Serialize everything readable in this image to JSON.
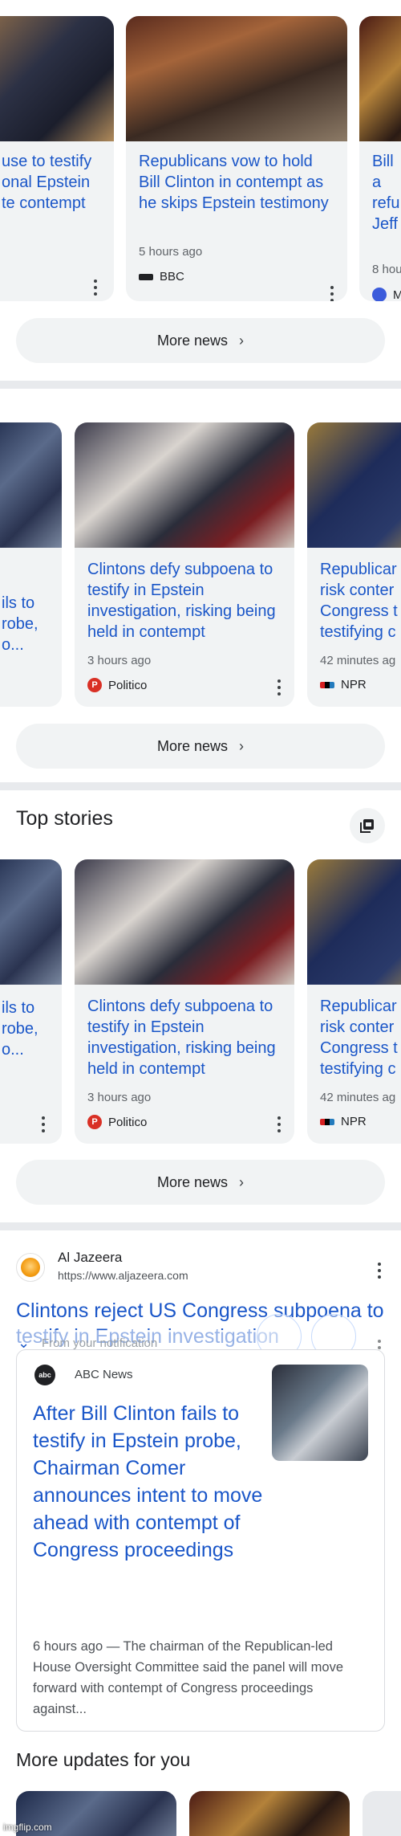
{
  "carousel1": {
    "cards": [
      {
        "title": "use to testify onal Epstein te contempt"
      },
      {
        "title": "Republicans vow to hold Bill Clinton in contempt as he skips Epstein testimony",
        "time": "5 hours ago",
        "source": "BBC"
      },
      {
        "title": "Bill a refu Jeff",
        "time": "8 hou",
        "source": "M"
      }
    ],
    "more_label": "More news"
  },
  "carousel2": {
    "cards": [
      {
        "title": "ils to robe, o..."
      },
      {
        "title": "Clintons defy subpoena to testify in Epstein investigation, risking being held in contempt",
        "time": "3 hours ago",
        "source": "Politico",
        "source_color": "#d93025",
        "source_letter": "P"
      },
      {
        "title": "Republicar risk conter Congress t testifying c",
        "time": "42 minutes ag",
        "source": "NPR"
      }
    ],
    "more_label": "More news"
  },
  "top_stories": {
    "heading": "Top stories",
    "cards": [
      {
        "title": "ils to robe, o..."
      },
      {
        "title": "Clintons defy subpoena to testify in Epstein investigation, risking being held in contempt",
        "time": "3 hours ago",
        "source": "Politico",
        "source_letter": "P"
      },
      {
        "title": "Republicar risk conter Congress t testifying c",
        "time": "42 minutes ag",
        "source": "NPR"
      }
    ],
    "more_label": "More news"
  },
  "aljazeera": {
    "site_name": "Al Jazeera",
    "url": "https://www.aljazeera.com",
    "headline": "Clintons reject US Congress subpoena to testify in Epstein investigation",
    "overlay_text": "From your notification"
  },
  "abc_card": {
    "source": "ABC News",
    "source_logo_text": "abc",
    "headline": "After Bill Clinton fails to testify in Epstein probe, Chairman Comer announces intent to move ahead with contempt of Congress proceedings",
    "snippet": "6 hours ago — The chairman of the Republican-led House Oversight Committee said the panel will move forward with contempt of Congress proceedings against..."
  },
  "more_updates": {
    "heading": "More updates for you"
  },
  "watermark": "imgflip.com",
  "colors": {
    "link_blue": "#1a56c8",
    "card_bg": "#f1f3f4",
    "politico_red": "#d93025",
    "aljazeera_orange": "#f39c12"
  }
}
